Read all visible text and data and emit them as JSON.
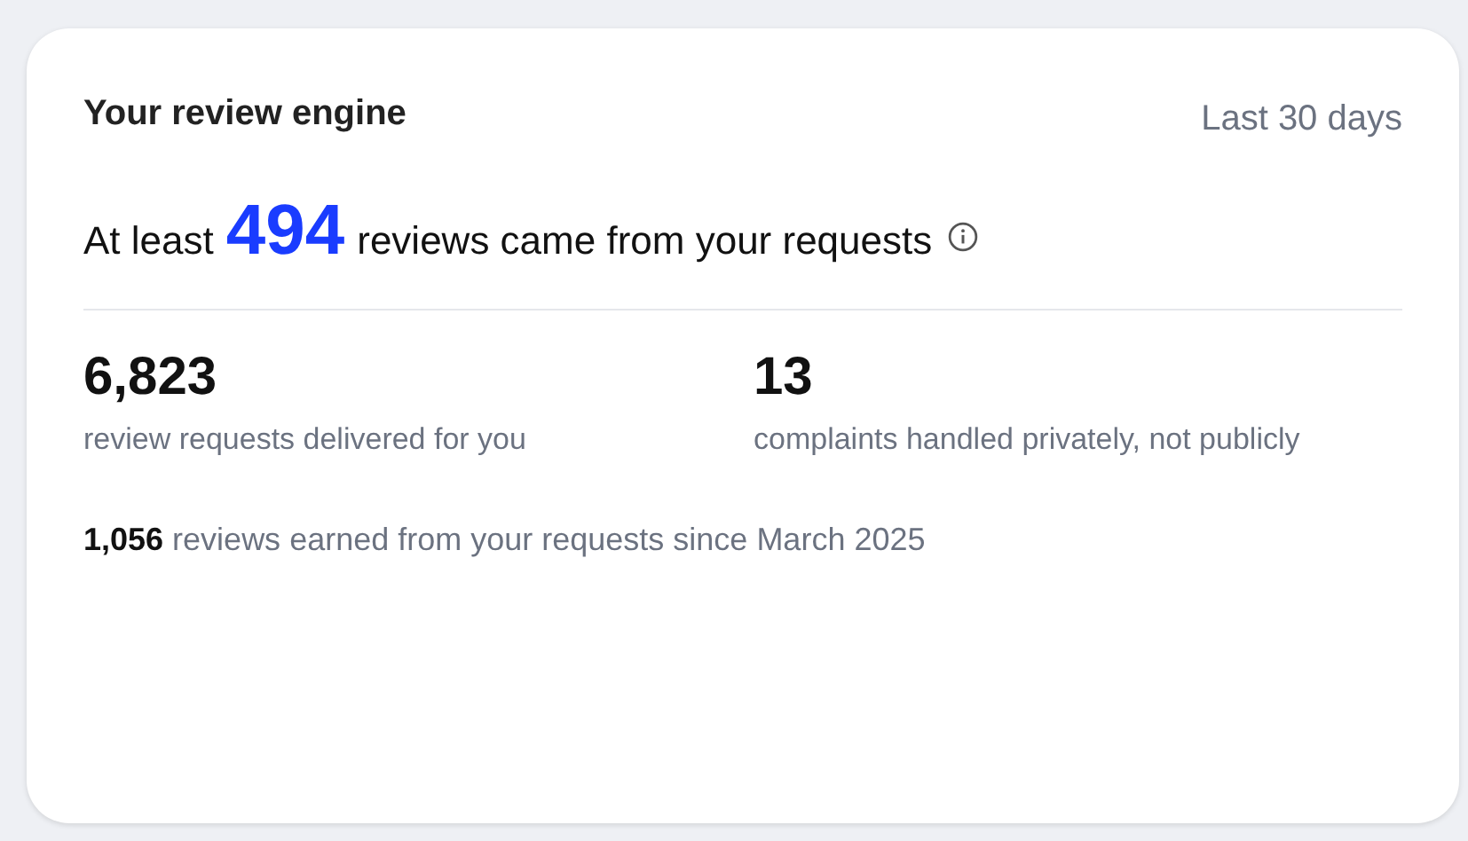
{
  "card": {
    "title": "Your review engine",
    "period": "Last 30 days",
    "headline": {
      "prefix": "At least",
      "number": "494",
      "suffix": "reviews came from your requests"
    },
    "stats": [
      {
        "value": "6,823",
        "label": "review requests delivered for you"
      },
      {
        "value": "13",
        "label": "complaints handled privately, not publicly"
      }
    ],
    "footer": "**1,056** reviews earned from your requests since March 2025"
  }
}
